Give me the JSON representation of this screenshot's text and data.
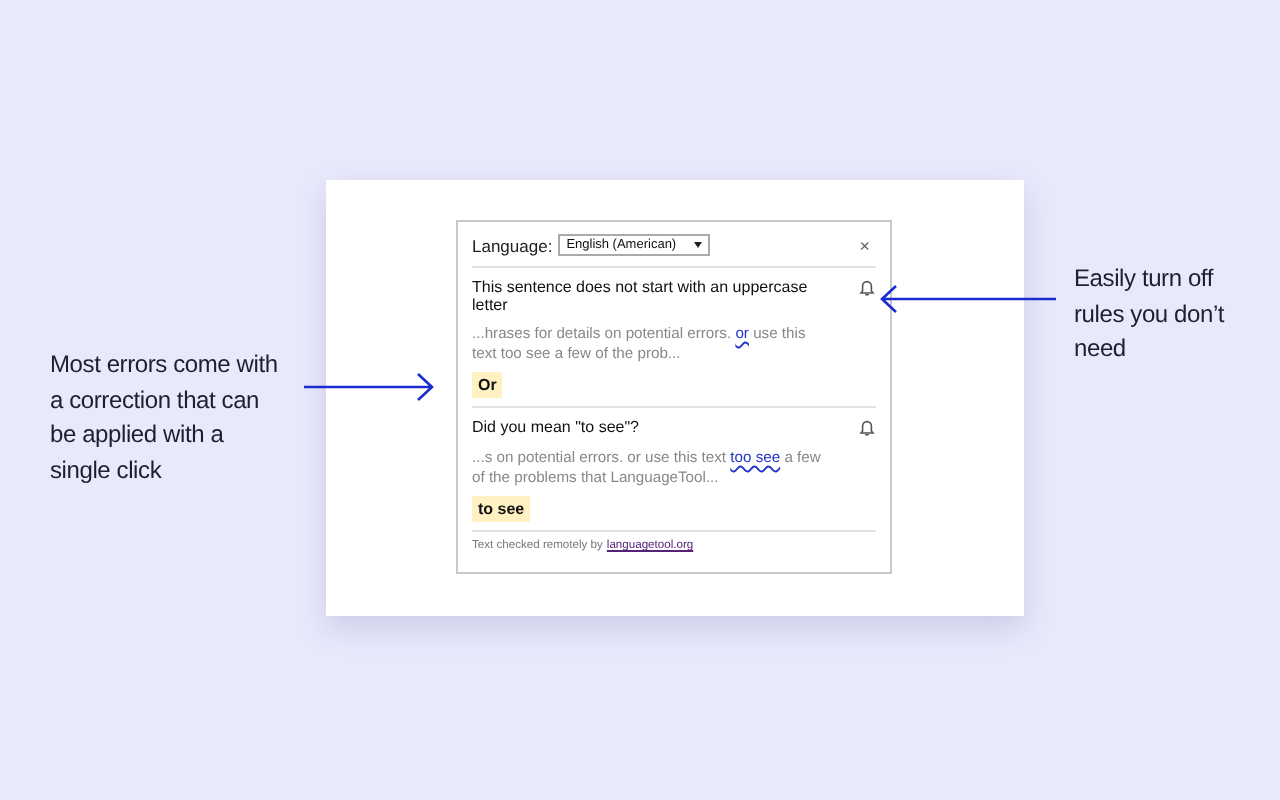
{
  "left_callout": {
    "lines": [
      "Most errors come with",
      "a correction that can",
      "be applied with a",
      "single click"
    ]
  },
  "right_callout": {
    "lines": [
      "Easily turn off",
      "rules you don’t",
      "need"
    ]
  },
  "popup": {
    "language_label": "Language:",
    "language": "English (American)",
    "close": "×",
    "errors": [
      {
        "message": "This sentence does not start with an uppercase letter",
        "context_before": "...hrases for details on potential errors. ",
        "error_text": "or",
        "context_after": " use this text too see a few of the prob...",
        "suggestion": "Or"
      },
      {
        "message": "Did you mean \"to see\"?",
        "context_before": "...s on potential errors. or use this text ",
        "error_text": "too see",
        "context_after": " a few of the problems that LanguageTool...",
        "suggestion": "to see"
      }
    ],
    "footer_text": "Text checked remotely by",
    "footer_link": "languagetool.org"
  }
}
